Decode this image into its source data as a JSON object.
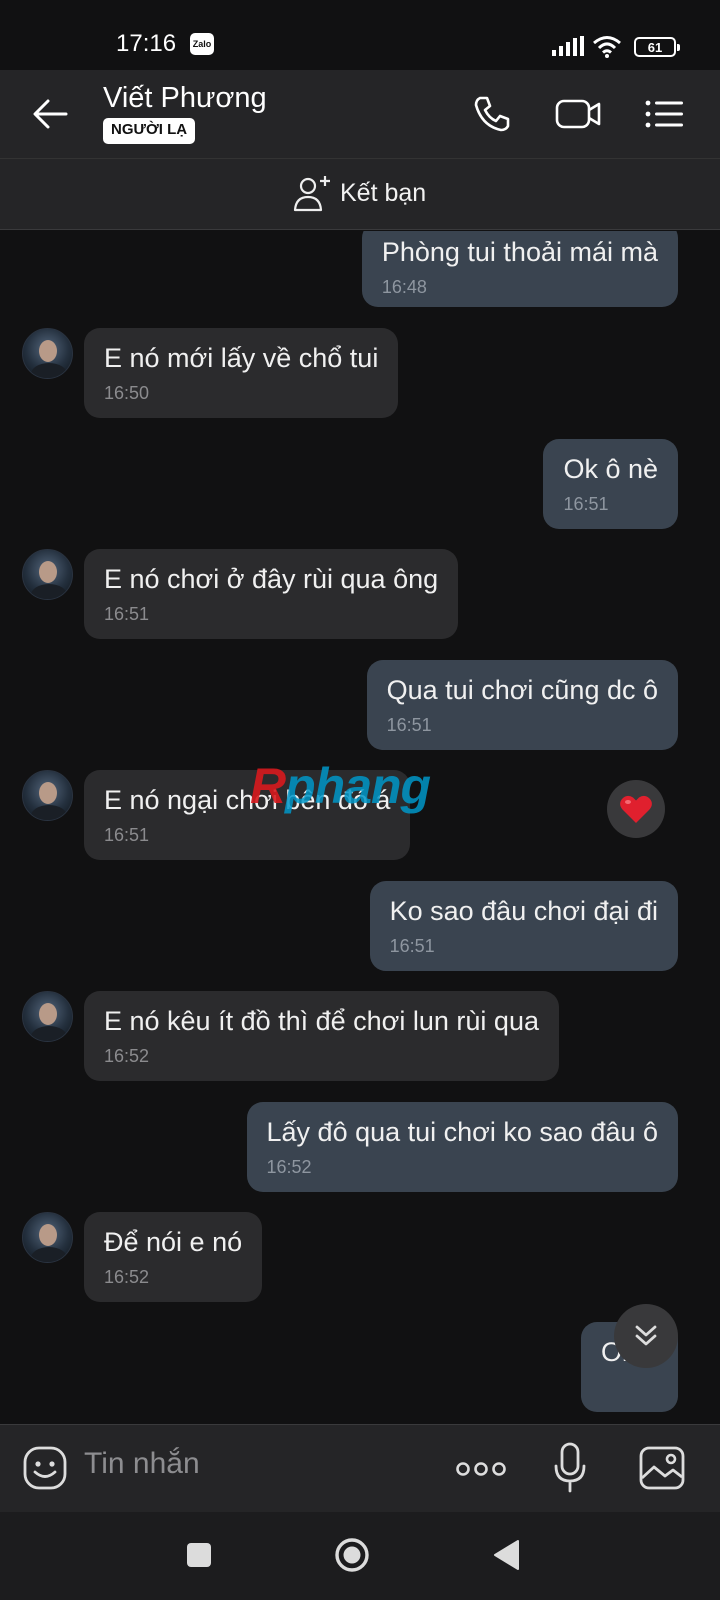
{
  "status_bar": {
    "time": "17:16",
    "app_badge": "Zalo",
    "battery": "61"
  },
  "header": {
    "contact_name": "Viết Phương",
    "badge": "NGƯỜI LẠ"
  },
  "add_friend": {
    "label": "Kết bạn"
  },
  "messages": [
    {
      "direction": "out",
      "text": "Phòng tui thoải mái mà",
      "time": "16:48"
    },
    {
      "direction": "in",
      "text": "E nó mới lấy về chổ tui",
      "time": "16:50"
    },
    {
      "direction": "out",
      "text": "Ok ô nè",
      "time": "16:51"
    },
    {
      "direction": "in",
      "text": "E nó chơi ở đây rùi qua ông",
      "time": "16:51"
    },
    {
      "direction": "out",
      "text": "Qua tui chơi cũng dc ô",
      "time": "16:51"
    },
    {
      "direction": "in",
      "text": "E nó ngại chơi bên đó á",
      "time": "16:51",
      "reaction": "heart"
    },
    {
      "direction": "out",
      "text": "Ko sao đâu chơi đại đi",
      "time": "16:51"
    },
    {
      "direction": "in",
      "text": "E nó kêu ít đồ thì để chơi lun rùi qua",
      "time": "16:52"
    },
    {
      "direction": "out",
      "text": "Lấy đô qua tui chơi ko sao đâu ô",
      "time": "16:52"
    },
    {
      "direction": "in",
      "text": "Để nói e nó",
      "time": "16:52"
    },
    {
      "direction": "out",
      "text": "Ok ô",
      "time": ""
    }
  ],
  "watermark": {
    "first": "R",
    "rest": "phang"
  },
  "composer": {
    "placeholder": "Tin nhắn"
  },
  "colors": {
    "background": "#111112",
    "incoming_bubble": "#2b2b2d",
    "outgoing_bubble": "#3a4450",
    "header": "#252527",
    "reaction_heart": "#e0202e"
  },
  "icons": {
    "back": "arrow-left-icon",
    "call": "phone-icon",
    "video": "video-camera-icon",
    "menu": "list-menu-icon",
    "add_friend": "add-person-icon",
    "emoji": "emoji-icon",
    "more": "more-dots-icon",
    "mic": "microphone-icon",
    "image": "image-icon",
    "scroll": "chevron-double-down-icon"
  }
}
